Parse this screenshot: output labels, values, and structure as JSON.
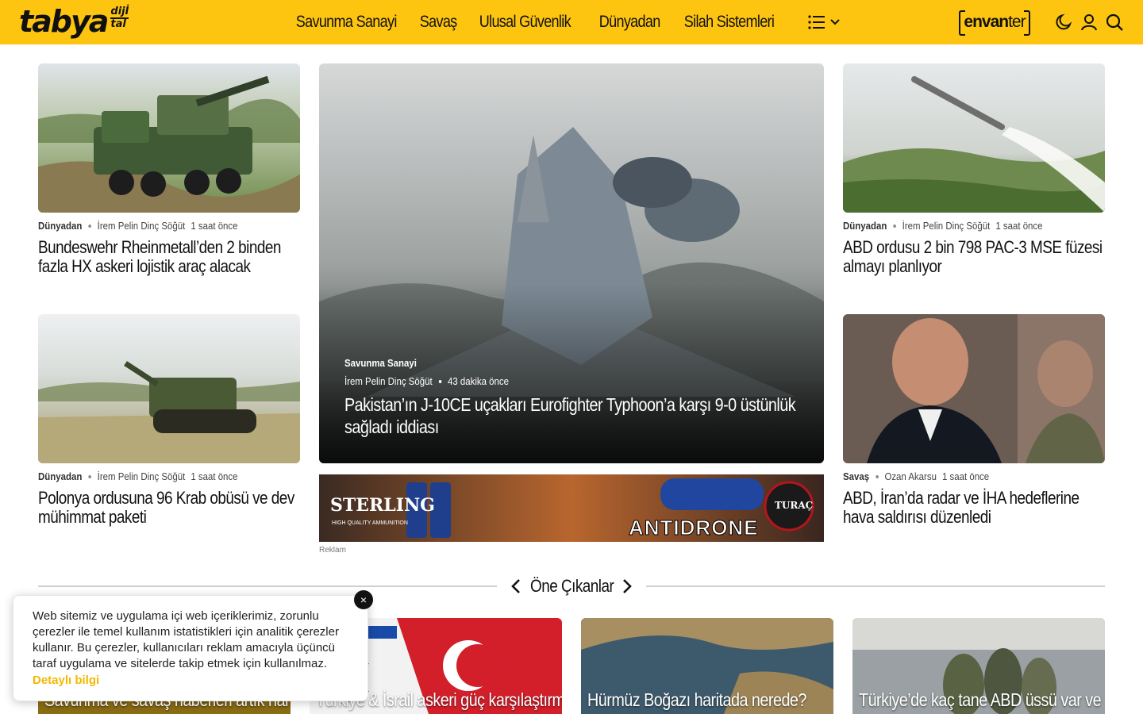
{
  "header": {
    "logo_main": "tabya",
    "logo_sub_top": "dijİ",
    "logo_sub_bottom": "tal",
    "nav": [
      "Savunma Sanayi",
      "Savaş",
      "Ulusal Güvenlik",
      "Dünyadan",
      "Silah Sistemleri"
    ],
    "envanter_bold": "envan",
    "envanter_light": "ter",
    "icons": [
      "menu-list-icon",
      "chevron-down-icon",
      "moon-icon",
      "user-icon",
      "search-icon"
    ]
  },
  "cards": [
    {
      "category": "Dünyadan",
      "author": "İrem Pelin Dinç Söğüt",
      "time": "1 saat önce",
      "title": "Bundeswehr Rheinmetall’den 2 binden fazla HX askeri lojistik araç alacak"
    },
    {
      "category": "Dünyadan",
      "author": "İrem Pelin Dinç Söğüt",
      "time": "1 saat önce",
      "title": "Polonya ordusuna 96 Krab obüsü ve dev mühimmat paketi"
    },
    {
      "category": "Dünyadan",
      "author": "İrem Pelin Dinç Söğüt",
      "time": "1 saat önce",
      "title": "ABD ordusu 2 bin 798 PAC-3 MSE füzesi almayı planlıyor"
    },
    {
      "category": "Savaş",
      "author": "Ozan Akarsu",
      "time": "1 saat önce",
      "title": "ABD, İran’da radar ve İHA hedeflerine hava saldırısı düzenledi"
    }
  ],
  "featured": {
    "category": "Savunma Sanayi",
    "author": "İrem Pelin Dinç Söğüt",
    "time": "43 dakika önce",
    "title": "Pakistan’ın J-10CE uçakları Eurofighter Typhoon’a karşı 9-0 üstünlük sağladı iddiası"
  },
  "ad": {
    "brand": "STERLING",
    "brand_sub": "HIGH QUALITY AMMUNITION",
    "product": "ANTIDRONE",
    "partner": "TURAÇ",
    "label": "Reklam"
  },
  "section": {
    "title": "Öne Çıkanlar",
    "cards": [
      "Savunma ve savaş haberleri artık harita",
      "Türkiye & İsrail askeri güç karşılaştırması",
      "Hürmüz Boğazı haritada nerede?",
      "Türkiye’de kaç tane ABD üssü var ve"
    ]
  },
  "cookie": {
    "text": "Web sitemiz ve uygulama içi web içeriklerimiz, zorunlu çerezler ile temel kullanım istatistikleri için analitik çerezler kullanır. Bu çerezler, kullanıcıları reklam amacıyla üçüncü taraf uygulama ve sitelerde takip etmek için kullanılmaz.",
    "link": "Detaylı bilgi",
    "close": "×"
  },
  "colors": {
    "brand_yellow": "#fdc50f",
    "link_yellow": "#f2b800"
  }
}
